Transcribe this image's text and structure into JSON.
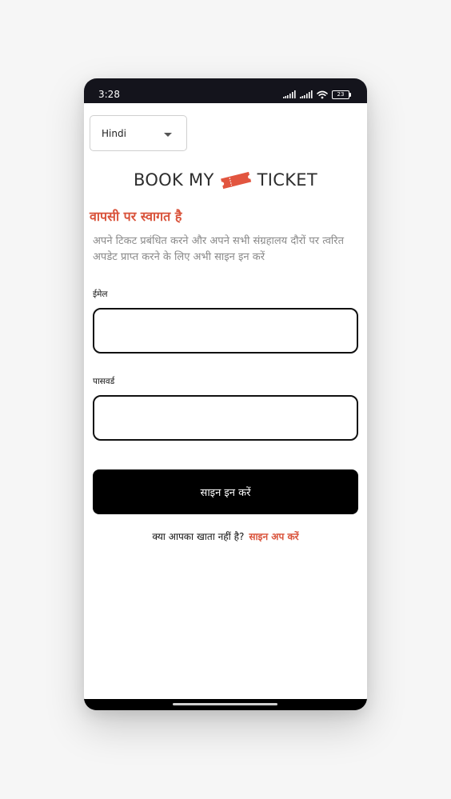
{
  "status_bar": {
    "time": "3:28",
    "battery": "23"
  },
  "language": {
    "selected": "Hindi"
  },
  "logo": {
    "left": "BOOK MY",
    "right": "TICKET",
    "accent_color": "#e2553f"
  },
  "welcome": {
    "title": "वापसी पर स्वागत है",
    "description": "अपने टिकट प्रबंधित करने और अपने सभी संग्रहालय दौरों पर त्वरित अपडेट प्राप्त करने के लिए अभी साइन इन करें"
  },
  "form": {
    "email_label": "ईमेल",
    "email_value": "",
    "password_label": "पासवर्ड",
    "password_value": "",
    "signin_label": "साइन इन करें"
  },
  "signup": {
    "prompt": "क्या आपका खाता नहीं है?",
    "link": "साइन अप करें"
  },
  "colors": {
    "accent": "#d9533b",
    "button_bg": "#000000",
    "status_bar_bg": "#14141c"
  }
}
